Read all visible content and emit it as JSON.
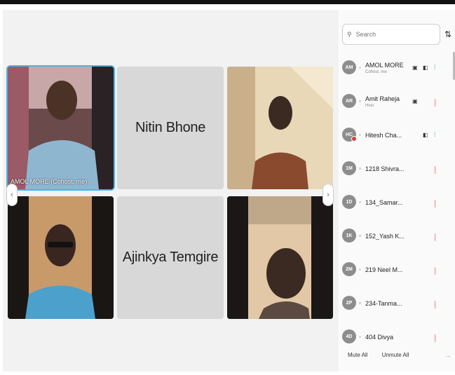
{
  "meeting": {
    "tiles": [
      {
        "kind": "video",
        "caption": "AMOL MORE (Cohost, me)",
        "active": true
      },
      {
        "kind": "name",
        "name": "Nitin Bhone"
      },
      {
        "kind": "video",
        "caption": ""
      },
      {
        "kind": "video",
        "caption": ""
      },
      {
        "kind": "name",
        "name": "Ajinkya Temgire"
      },
      {
        "kind": "video",
        "caption": ""
      }
    ],
    "prev_icon": "chevron-left-icon",
    "next_icon": "chevron-right-icon"
  },
  "panel": {
    "search_placeholder": "Search",
    "sort_icon": "sort-icon",
    "participants": [
      {
        "initials": "AM",
        "name": "AMOL MORE",
        "sub": "Cohost, me",
        "share": true,
        "video": true,
        "mic": "on"
      },
      {
        "initials": "AR",
        "name": "Amit Raheja",
        "sub": "Host",
        "share": true,
        "video": false,
        "mic": "off"
      },
      {
        "initials": "HC",
        "name": "Hitesh Cha...",
        "sub": "",
        "share": false,
        "video": true,
        "mic": "on"
      },
      {
        "initials": "1M",
        "name": "1218 Shivra...",
        "sub": "",
        "share": false,
        "video": false,
        "mic": "off"
      },
      {
        "initials": "1D",
        "name": "134_Samar...",
        "sub": "",
        "share": false,
        "video": false,
        "mic": "off"
      },
      {
        "initials": "1K",
        "name": "152_Yash K...",
        "sub": "",
        "share": false,
        "video": false,
        "mic": "off"
      },
      {
        "initials": "2M",
        "name": "219 Neel M...",
        "sub": "",
        "share": false,
        "video": false,
        "mic": "off"
      },
      {
        "initials": "2P",
        "name": "234-Tanma...",
        "sub": "",
        "share": false,
        "video": false,
        "mic": "off"
      },
      {
        "initials": "4D",
        "name": "404 Divya",
        "sub": "",
        "share": false,
        "video": false,
        "mic": "off"
      }
    ],
    "mute_all": "Mute All",
    "unmute_all": "Unmute All",
    "more": "..."
  }
}
